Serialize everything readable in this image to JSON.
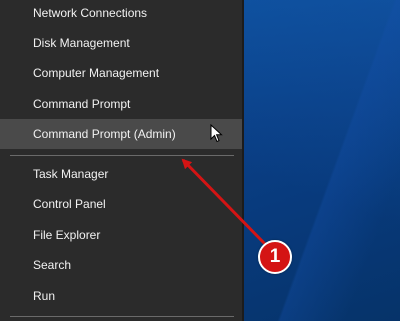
{
  "menu": {
    "items": [
      {
        "label": "Network Connections"
      },
      {
        "label": "Disk Management"
      },
      {
        "label": "Computer Management"
      },
      {
        "label": "Command Prompt"
      },
      {
        "label": "Command Prompt (Admin)",
        "highlighted": true
      },
      {
        "label": "Task Manager"
      },
      {
        "label": "Control Panel"
      },
      {
        "label": "File Explorer"
      },
      {
        "label": "Search"
      },
      {
        "label": "Run"
      }
    ]
  },
  "annotation": {
    "step_number": "1",
    "color": "#d41414"
  },
  "colors": {
    "menu_background": "#2b2b2b",
    "menu_hover": "#4a4a4a",
    "menu_text": "#f2f2f2",
    "desktop": "#0a3f86"
  }
}
